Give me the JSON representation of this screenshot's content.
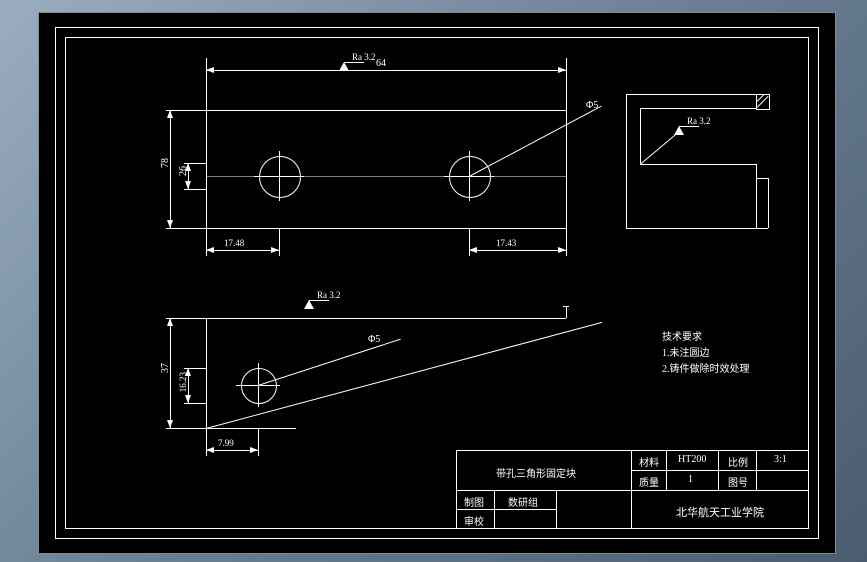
{
  "surface_finish_top": "Ra 3.2",
  "surface_finish_mid": "Ra 3.2",
  "surface_finish_side": "Ra 3.2",
  "dims": {
    "width_64": "64",
    "height_78": "78",
    "height_26": "26",
    "dim_17_48": "17.48",
    "dim_17_43": "17.43",
    "height_37": "37",
    "dim_16_23": "16.23",
    "dim_7_99": "7.99",
    "dia_top": "Φ5",
    "dia_bot": "Φ5"
  },
  "tech_req": {
    "title": "技术要求",
    "line1": "1.未注圆边",
    "line2": "2.铸件做除时效处理"
  },
  "title_block": {
    "part_name": "带孔三角形固定块",
    "drawn_label": "制图",
    "drawn_by": "数研组",
    "check_label": "审校",
    "material_label": "材料",
    "material": "HT200",
    "scale_label": "比例",
    "scale": "3:1",
    "weight_label": "质量",
    "weight": "1",
    "sheet_label": "图号",
    "institution": "北华航天工业学院"
  }
}
